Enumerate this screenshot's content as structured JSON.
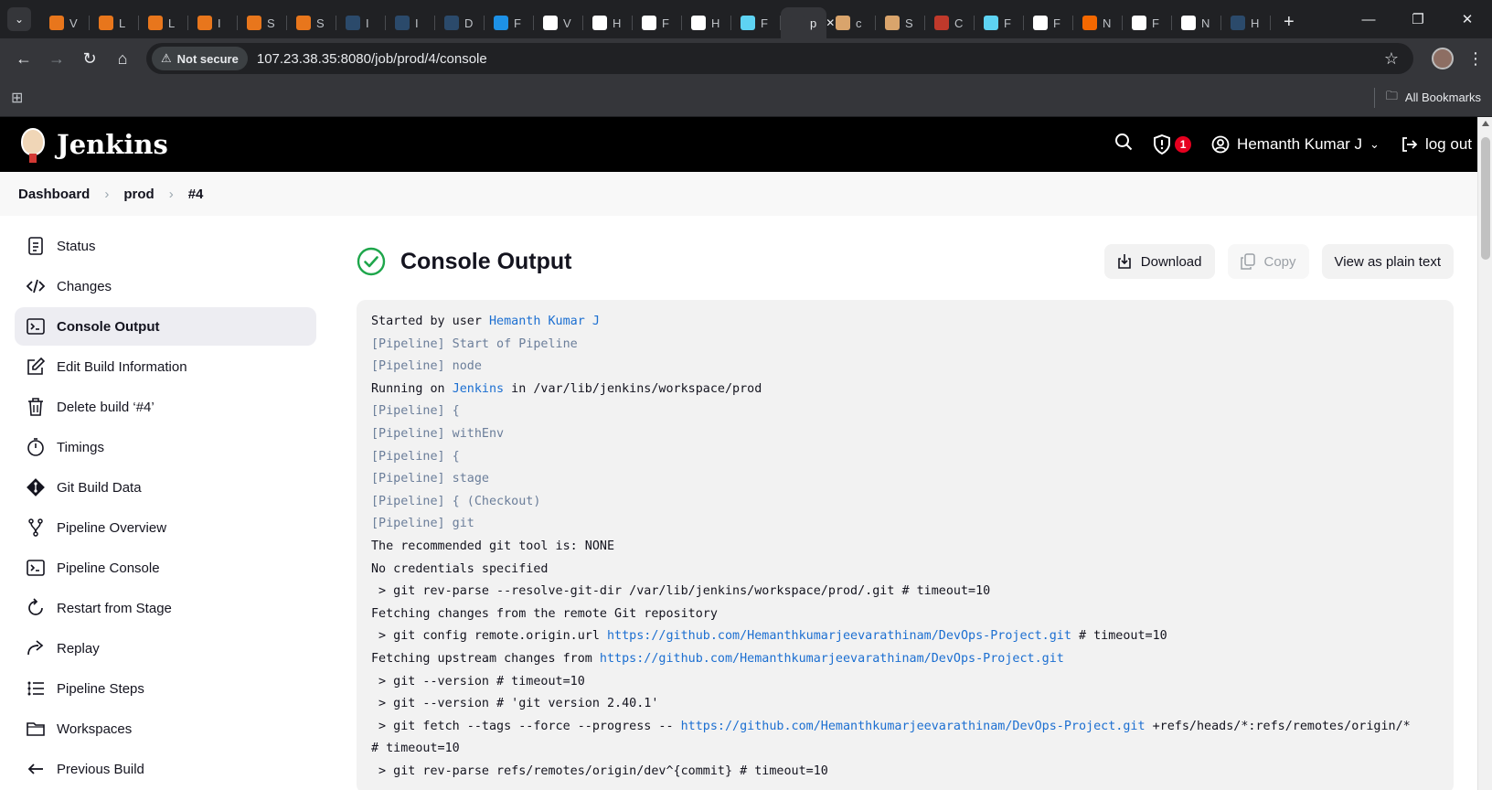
{
  "browser": {
    "tabs": [
      {
        "initial": "V",
        "fav": "#e8761c"
      },
      {
        "initial": "L",
        "fav": "#e8761c"
      },
      {
        "initial": "L",
        "fav": "#e8761c"
      },
      {
        "initial": "I",
        "fav": "#e8761c"
      },
      {
        "initial": "S",
        "fav": "#e8761c"
      },
      {
        "initial": "S",
        "fav": "#e8761c"
      },
      {
        "initial": "I",
        "fav": "#2b4a6b"
      },
      {
        "initial": "I",
        "fav": "#2b4a6b"
      },
      {
        "initial": "D",
        "fav": "#2b4a6b"
      },
      {
        "initial": "F",
        "fav": "#1d91e6"
      },
      {
        "initial": "V",
        "fav": "#ffffff"
      },
      {
        "initial": "H",
        "fav": "#ffffff"
      },
      {
        "initial": "F",
        "fav": "#ffffff"
      },
      {
        "initial": "H",
        "fav": "#ffffff"
      },
      {
        "initial": "F",
        "fav": "#5ed3f3"
      },
      {
        "initial": "p",
        "fav": "#35363a",
        "active": true
      },
      {
        "initial": "c",
        "fav": "#d9a46c"
      },
      {
        "initial": "S",
        "fav": "#d9a46c"
      },
      {
        "initial": "C",
        "fav": "#c0392b"
      },
      {
        "initial": "F",
        "fav": "#5ed3f3"
      },
      {
        "initial": "F",
        "fav": "#ffffff"
      },
      {
        "initial": "N",
        "fav": "#f46800"
      },
      {
        "initial": "F",
        "fav": "#ffffff"
      },
      {
        "initial": "N",
        "fav": "#ffffff"
      },
      {
        "initial": "H",
        "fav": "#2b4a6b"
      }
    ],
    "security_label": "Not secure",
    "url": "107.23.38.35:8080/job/prod/4/console",
    "all_bookmarks": "All Bookmarks"
  },
  "header": {
    "brand": "Jenkins",
    "alert_count": "1",
    "user_name": "Hemanth Kumar J",
    "logout_label": "log out"
  },
  "breadcrumb": [
    "Dashboard",
    "prod",
    "#4"
  ],
  "sidebar": {
    "items": [
      {
        "label": "Status",
        "icon": "status-icon"
      },
      {
        "label": "Changes",
        "icon": "code-icon"
      },
      {
        "label": "Console Output",
        "icon": "terminal-icon",
        "active": true
      },
      {
        "label": "Edit Build Information",
        "icon": "edit-icon"
      },
      {
        "label": "Delete build ‘#4’",
        "icon": "trash-icon"
      },
      {
        "label": "Timings",
        "icon": "stopwatch-icon"
      },
      {
        "label": "Git Build Data",
        "icon": "git-icon"
      },
      {
        "label": "Pipeline Overview",
        "icon": "branch-icon"
      },
      {
        "label": "Pipeline Console",
        "icon": "terminal-icon"
      },
      {
        "label": "Restart from Stage",
        "icon": "restart-icon"
      },
      {
        "label": "Replay",
        "icon": "replay-icon"
      },
      {
        "label": "Pipeline Steps",
        "icon": "list-icon"
      },
      {
        "label": "Workspaces",
        "icon": "folder-icon"
      },
      {
        "label": "Previous Build",
        "icon": "arrow-left-icon"
      }
    ]
  },
  "main": {
    "title": "Console Output",
    "download_label": "Download",
    "copy_label": "Copy",
    "plain_text_label": "View as plain text"
  },
  "console": {
    "lines": [
      {
        "parts": [
          {
            "t": "Started by user "
          },
          {
            "t": "Hemanth Kumar J",
            "link": true
          }
        ]
      },
      {
        "pipeline": true,
        "parts": [
          {
            "t": "[Pipeline] Start of Pipeline"
          }
        ]
      },
      {
        "pipeline": true,
        "parts": [
          {
            "t": "[Pipeline] node"
          }
        ]
      },
      {
        "parts": [
          {
            "t": "Running on "
          },
          {
            "t": "Jenkins",
            "link": true
          },
          {
            "t": " in /var/lib/jenkins/workspace/prod"
          }
        ]
      },
      {
        "pipeline": true,
        "parts": [
          {
            "t": "[Pipeline] {"
          }
        ]
      },
      {
        "pipeline": true,
        "parts": [
          {
            "t": "[Pipeline] withEnv"
          }
        ]
      },
      {
        "pipeline": true,
        "parts": [
          {
            "t": "[Pipeline] {"
          }
        ]
      },
      {
        "pipeline": true,
        "parts": [
          {
            "t": "[Pipeline] stage"
          }
        ]
      },
      {
        "pipeline": true,
        "parts": [
          {
            "t": "[Pipeline] { (Checkout)"
          }
        ]
      },
      {
        "pipeline": true,
        "parts": [
          {
            "t": "[Pipeline] git"
          }
        ]
      },
      {
        "parts": [
          {
            "t": "The recommended git tool is: NONE"
          }
        ]
      },
      {
        "parts": [
          {
            "t": "No credentials specified"
          }
        ]
      },
      {
        "parts": [
          {
            "t": " > git rev-parse --resolve-git-dir /var/lib/jenkins/workspace/prod/.git # timeout=10"
          }
        ]
      },
      {
        "parts": [
          {
            "t": "Fetching changes from the remote Git repository"
          }
        ]
      },
      {
        "parts": [
          {
            "t": " > git config remote.origin.url "
          },
          {
            "t": "https://github.com/Hemanthkumarjeevarathinam/DevOps-Project.git",
            "link": true
          },
          {
            "t": " # timeout=10"
          }
        ]
      },
      {
        "parts": [
          {
            "t": "Fetching upstream changes from "
          },
          {
            "t": "https://github.com/Hemanthkumarjeevarathinam/DevOps-Project.git",
            "link": true
          }
        ]
      },
      {
        "parts": [
          {
            "t": " > git --version # timeout=10"
          }
        ]
      },
      {
        "parts": [
          {
            "t": " > git --version # 'git version 2.40.1'"
          }
        ]
      },
      {
        "parts": [
          {
            "t": " > git fetch --tags --force --progress -- "
          },
          {
            "t": "https://github.com/Hemanthkumarjeevarathinam/DevOps-Project.git",
            "link": true
          },
          {
            "t": " +refs/heads/*:refs/remotes/origin/*"
          }
        ]
      },
      {
        "parts": [
          {
            "t": "# timeout=10"
          }
        ]
      },
      {
        "parts": [
          {
            "t": " > git rev-parse refs/remotes/origin/dev^{commit} # timeout=10"
          }
        ]
      }
    ]
  },
  "colors": {
    "jenkins_header": "#000000",
    "success": "#1ea64b",
    "link": "#1c6fd1",
    "pipeline_text": "#6b7e9a"
  }
}
